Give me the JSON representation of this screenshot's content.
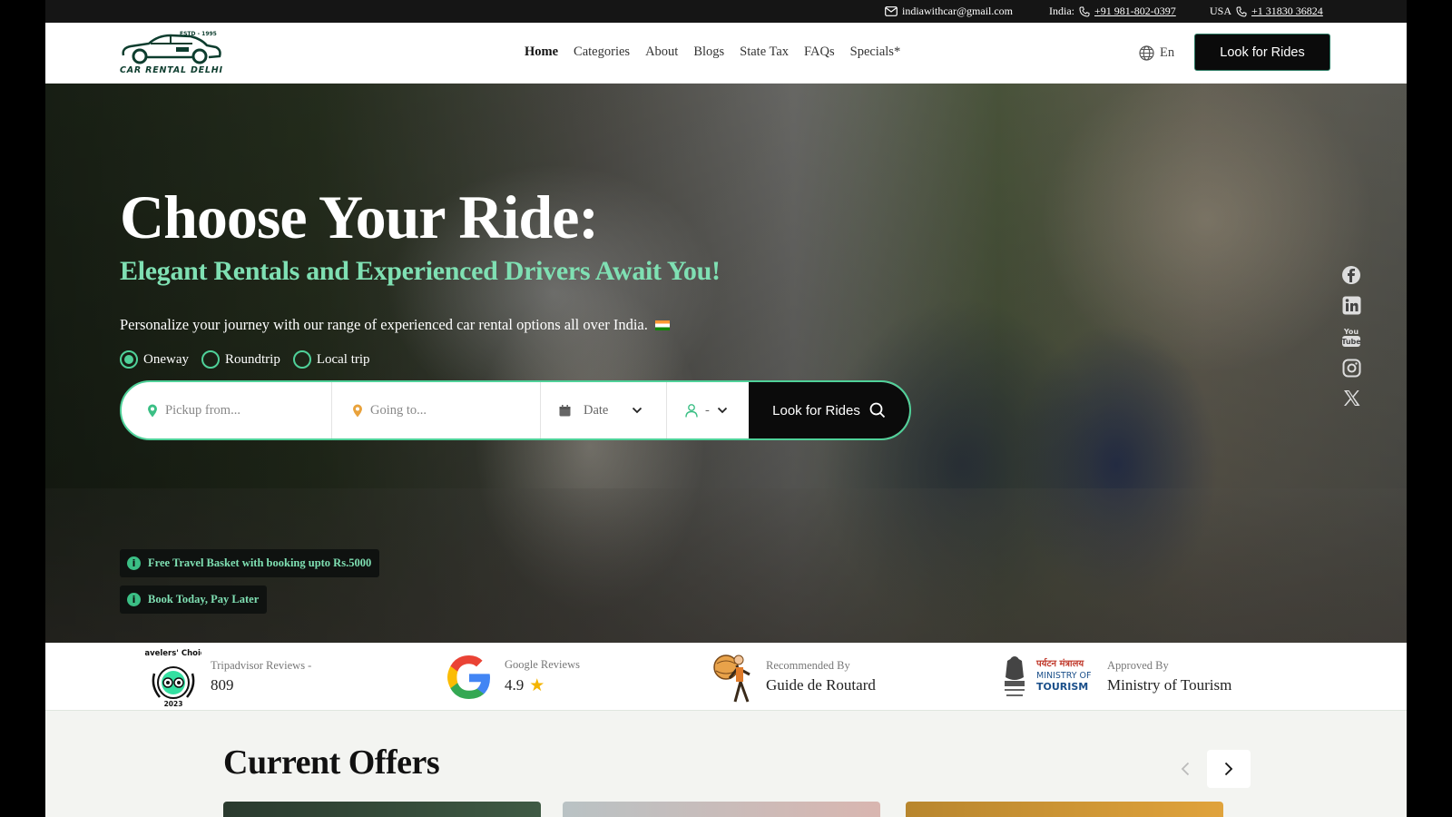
{
  "topbar": {
    "email": "indiawithcar@gmail.com",
    "india_label": "India:",
    "india_phone": "+91 981-802-0397",
    "usa_label": "USA",
    "usa_phone": "+1 31830 36824"
  },
  "brand": {
    "logo_text": "CAR RENTAL DELHI",
    "estd": "ESTD - 1995"
  },
  "nav": {
    "items": [
      "Home",
      "Categories",
      "About",
      "Blogs",
      "State Tax",
      "FAQs",
      "Specials*"
    ],
    "active": "Home",
    "language": "En",
    "cta": "Look for Rides"
  },
  "hero": {
    "title": "Choose Your Ride:",
    "subtitle": "Elegant Rentals and Experienced Drivers Await You!",
    "description": "Personalize your journey with our range of experienced car rental options all over India.",
    "trip_types": [
      "Oneway",
      "Roundtrip",
      "Local trip"
    ],
    "selected_trip": "Oneway",
    "search": {
      "pickup_placeholder": "Pickup from...",
      "going_placeholder": "Going to...",
      "date_label": "Date",
      "passengers_value": "-",
      "button": "Look for Rides"
    },
    "badges": [
      "Free Travel Basket with booking upto Rs.5000",
      "Book Today, Pay Later"
    ],
    "social_icons": [
      "facebook-icon",
      "linkedin-icon",
      "youtube-icon",
      "instagram-icon",
      "x-icon"
    ]
  },
  "reviews": [
    {
      "icon": "tripadvisor-travelers-choice-2023-icon",
      "badge_top": "Travelers' Choice",
      "badge_year": "2023",
      "label": "Tripadvisor Reviews -",
      "value": "809"
    },
    {
      "icon": "google-icon",
      "label": "Google Reviews",
      "value": "4.9",
      "star": "★"
    },
    {
      "icon": "guide-de-routard-icon",
      "label": "Recommended By",
      "value": "Guide de Routard"
    },
    {
      "icon": "ministry-of-tourism-emblem-icon",
      "emblem_hindi": "पर्यटन मंत्रालय",
      "emblem_en1": "MINISTRY OF",
      "emblem_en2": "TOURISM",
      "label": "Approved By",
      "value": "Ministry of Tourism"
    }
  ],
  "offers": {
    "title": "Current Offers"
  },
  "colors": {
    "accent": "#4fd199",
    "accent_text": "#7fe0b3",
    "dark": "#0b0b0b"
  }
}
